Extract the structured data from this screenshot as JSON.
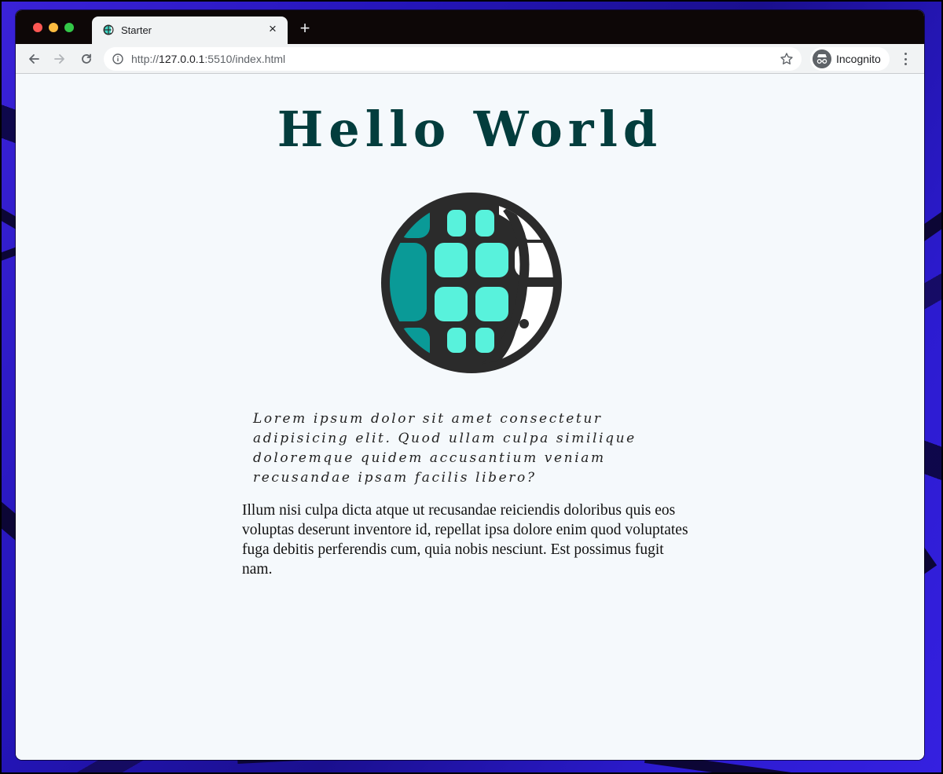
{
  "browser": {
    "tab": {
      "title": "Starter",
      "close_symbol": "×"
    },
    "new_tab_symbol": "+",
    "address": {
      "scheme": "http://",
      "host": "127.0.0.1",
      "rest": ":5510/index.html"
    },
    "incognito_label": "Incognito"
  },
  "page": {
    "heading": "Hello World",
    "intro": "Lorem ipsum dolor sit amet consectetur adipisicing elit. Quod ullam culpa similique doloremque quidem accusantium veniam recusandae ipsam facilis libero?",
    "body": "Illum nisi culpa dicta atque ut recusandae reiciendis doloribus quis eos voluptas deserunt inventore id, repellat ipsa dolore enim quod voluptates fuga debitis perferendis cum, quia nobis nesciunt. Est possimus fugit nam."
  },
  "icons": {
    "favicon": "globe-icon",
    "back": "arrow-back-icon",
    "forward": "arrow-forward-icon",
    "reload": "reload-icon",
    "info": "info-icon",
    "bookmark": "star-icon",
    "incognito": "incognito-icon",
    "menu": "kebab-menu-icon",
    "illustration": "globe-icon"
  },
  "colors": {
    "heading": "#033d3d",
    "globe_outline": "#2b2b2b",
    "globe_light": "#58f2dc",
    "globe_dark": "#0a9a97",
    "globe_white": "#ffffff",
    "page_background": "#f5f9fc"
  }
}
